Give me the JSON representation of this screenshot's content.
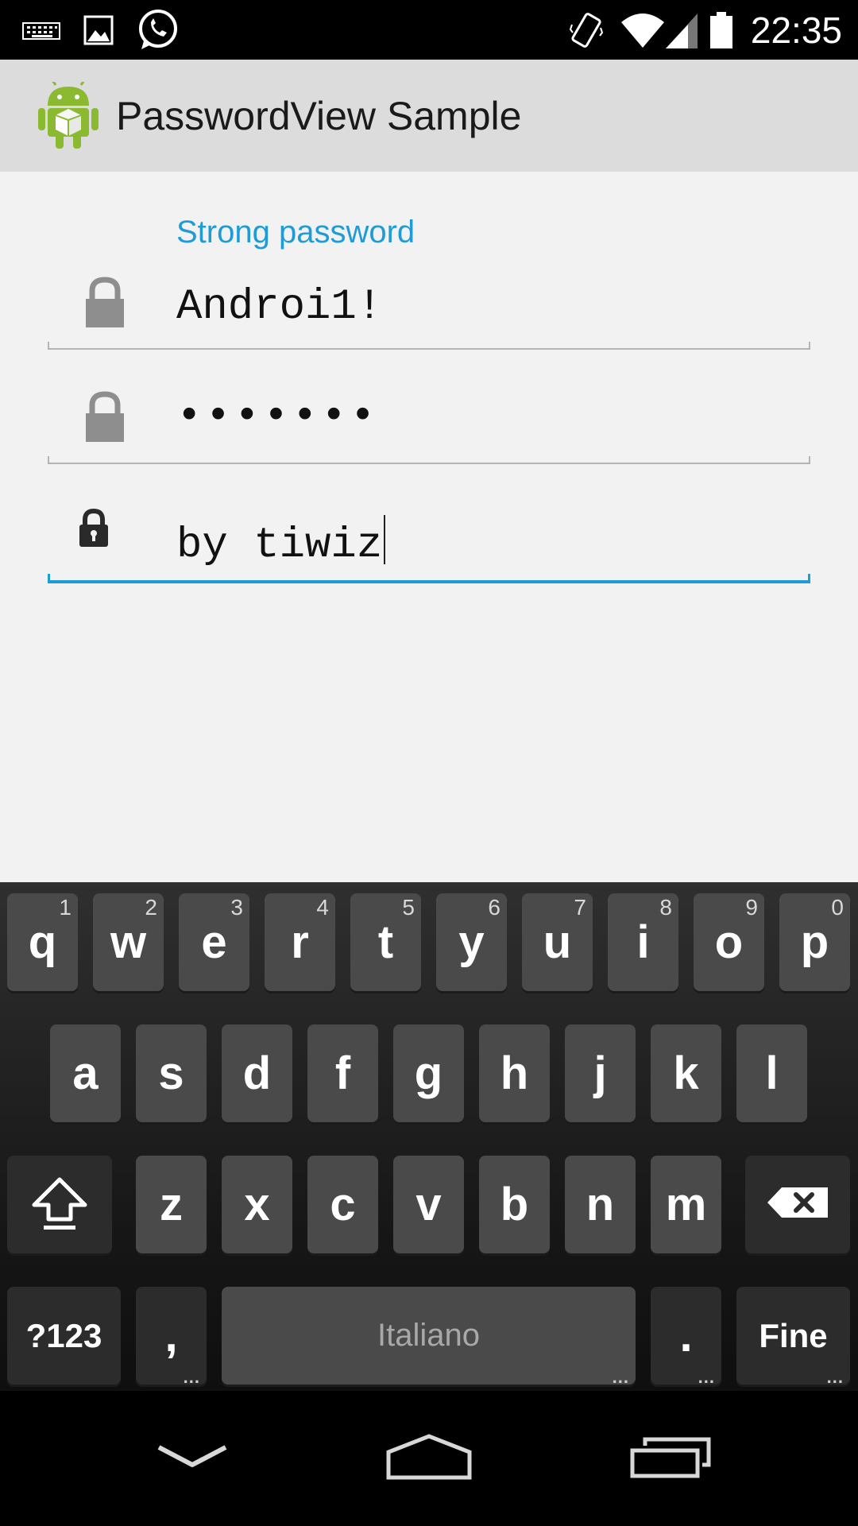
{
  "status_bar": {
    "time": "22:35",
    "left_icons": [
      "keyboard-icon",
      "image-icon",
      "whatsapp-icon"
    ],
    "right_icons": [
      "vibrate-icon",
      "wifi-icon",
      "signal-icon",
      "battery-icon"
    ]
  },
  "action_bar": {
    "title": "PasswordView Sample",
    "icon": "android-app-icon"
  },
  "form": {
    "strength_label": "Strong password",
    "fields": [
      {
        "value": "Androi1!",
        "icon": "lock-icon",
        "state": "visible"
      },
      {
        "value": "•••••••",
        "icon": "lock-icon",
        "state": "masked"
      },
      {
        "value": "by tiwiz",
        "icon": "lock-small-icon",
        "state": "focused"
      }
    ]
  },
  "keyboard": {
    "row1": [
      {
        "label": "q",
        "hint": "1"
      },
      {
        "label": "w",
        "hint": "2"
      },
      {
        "label": "e",
        "hint": "3"
      },
      {
        "label": "r",
        "hint": "4"
      },
      {
        "label": "t",
        "hint": "5"
      },
      {
        "label": "y",
        "hint": "6"
      },
      {
        "label": "u",
        "hint": "7"
      },
      {
        "label": "i",
        "hint": "8"
      },
      {
        "label": "o",
        "hint": "9"
      },
      {
        "label": "p",
        "hint": "0"
      }
    ],
    "row2": [
      "a",
      "s",
      "d",
      "f",
      "g",
      "h",
      "j",
      "k",
      "l"
    ],
    "row3": [
      "z",
      "x",
      "c",
      "v",
      "b",
      "n",
      "m"
    ],
    "symbols_label": "?123",
    "comma_label": ",",
    "space_label": "Italiano",
    "period_label": ".",
    "done_label": "Fine"
  },
  "nav_bar": {
    "icons": [
      "back-down-icon",
      "home-icon",
      "recents-icon"
    ]
  },
  "colors": {
    "accent": "#1f9bd6",
    "key": "#4a4a4a",
    "action_bar": "#dcdcdc",
    "content_bg": "#f2f2f2"
  }
}
